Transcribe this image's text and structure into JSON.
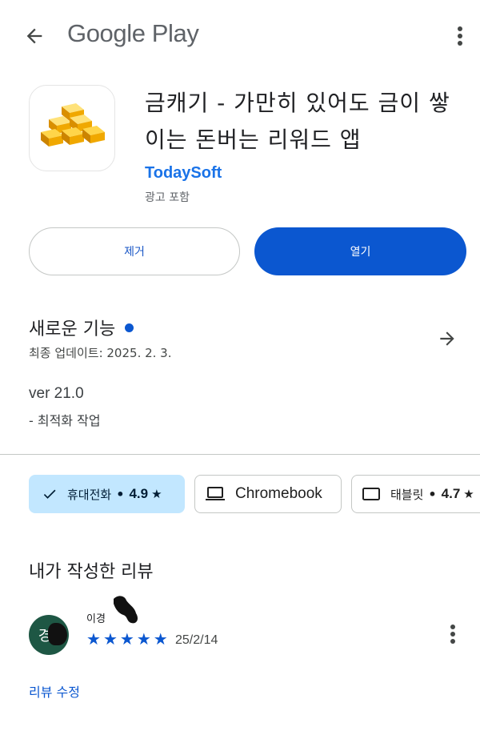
{
  "header": {
    "back_icon": "arrow-left-icon",
    "store_name": "Google Play",
    "more_icon": "more-vert-icon"
  },
  "app": {
    "icon": "gold-bars-icon",
    "title": "금캐기 - 가만히 있어도 금이 쌓이는 돈버는 리워드 앱",
    "developer": "TodaySoft",
    "ads_note": "광고 포함"
  },
  "actions": {
    "remove_label": "제거",
    "open_label": "열기"
  },
  "whats_new": {
    "title": "새로운 기능",
    "last_updated": "최종 업데이트: 2025. 2. 3.",
    "version": "ver 21.0",
    "notes": "- 최적화 작업"
  },
  "devices": [
    {
      "label": "휴대전화",
      "rating": "4.9",
      "selected": true,
      "icon": "check-icon"
    },
    {
      "label": "Chromebook",
      "rating": "",
      "selected": false,
      "icon": "laptop-icon"
    },
    {
      "label": "태블릿",
      "rating": "4.7",
      "selected": false,
      "icon": "tablet-icon"
    }
  ],
  "my_review": {
    "section_title": "내가 작성한 리뷰",
    "avatar_initial": "경",
    "reviewer_name": "이경",
    "stars": 5,
    "date": "25/2/14",
    "edit_label": "리뷰 수정"
  },
  "colors": {
    "accent": "#0b57d0",
    "developer_link": "#1a73e8",
    "chip_selected_bg": "#c2e7ff",
    "avatar_bg": "#1e5744"
  }
}
